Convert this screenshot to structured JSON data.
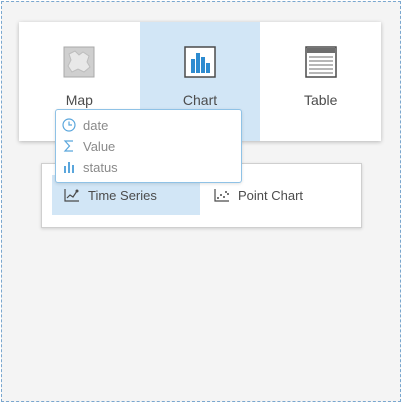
{
  "visualization_types": [
    {
      "label": "Map",
      "icon": "map-icon",
      "active": false
    },
    {
      "label": "Chart",
      "icon": "bar-chart-icon",
      "active": true
    },
    {
      "label": "Table",
      "icon": "table-icon",
      "active": false
    }
  ],
  "chart_subtypes": [
    {
      "label": "Time Series",
      "icon": "time-series-icon",
      "active": true
    },
    {
      "label": "Point Chart",
      "icon": "point-chart-icon",
      "active": false
    }
  ],
  "fields": [
    {
      "label": "date",
      "icon": "clock-icon"
    },
    {
      "label": "Value",
      "icon": "sigma-icon"
    },
    {
      "label": "status",
      "icon": "string-field-icon"
    }
  ],
  "colors": {
    "accent": "#2d8bd0",
    "active_background": "#d2e6f6",
    "popup_border": "#8fc2e6",
    "canvas_background": "#f4f4f4"
  }
}
